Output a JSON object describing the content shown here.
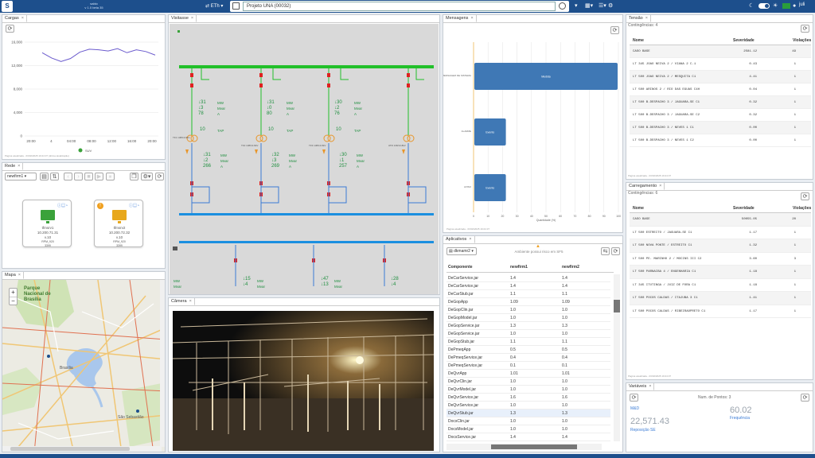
{
  "topbar": {
    "brand_line1": "sabio",
    "brand_line2": "v 1.0 beta 35",
    "eth_label": "ETh",
    "project": "Projeto UNA (00032)",
    "user": "juli"
  },
  "tabs": {
    "cargas": "Cargas",
    "visitasse": "Visitasse",
    "mensagens": "Mensagens",
    "tensao": "Tensão",
    "rede": "Rede",
    "mapa": "Mapa",
    "camera": "Câmera",
    "aplicativos": "Aplicativos",
    "carregamento": "Carregamento",
    "variaveis": "Variáveis"
  },
  "cargas": {
    "yticks": [
      "16,000",
      "12,000",
      "8,000",
      "4,000",
      "0"
    ],
    "xticks": [
      "20:00",
      "4",
      "04:00",
      "08:00",
      "12:00",
      "16:00",
      "20:00"
    ],
    "legend": "SUV",
    "footer": "Página atualizada - 03/02/2025 19:24:37 (última atualização)"
  },
  "rede": {
    "select": "newfirm1",
    "nodes": [
      {
        "name": "tfmsrv1",
        "ip": "10.200.71.31",
        "ver": "v.10",
        "os": "RPM_920",
        "code": "3399"
      },
      {
        "name": "tfmsrv2",
        "ip": "10.200.72.32",
        "ver": "v.10",
        "os": "RPM_920",
        "code": "3399"
      }
    ]
  },
  "mapa": {
    "park": "Parque Nacional de Brasília",
    "city": "Brasília",
    "place1": "São Sebastião",
    "zoom_in": "+",
    "zoom_out": "−"
  },
  "sld": {
    "feeders": [
      {
        "a": "31",
        "b": "3",
        "c": "78",
        "d": "10",
        "e": "31",
        "f": "2",
        "g": "266",
        "h": "15",
        "i": "4"
      },
      {
        "a": "31",
        "b": "0",
        "c": "80",
        "d": "10",
        "e": "32",
        "f": "3",
        "g": "269",
        "h": "",
        "i": ""
      },
      {
        "a": "30",
        "b": "2",
        "c": "76",
        "d": "10",
        "e": "30",
        "f": "1",
        "g": "257",
        "h": "47",
        "i": "13"
      }
    ],
    "last": {
      "h": "28",
      "i": "4"
    },
    "units": {
      "mw": "MW",
      "mvar": "Mvar",
      "a": "A",
      "tap": "TAP"
    },
    "trafos": [
      "TF1 138/13.8kV",
      "TF2 138/13.8kV",
      "TF3 138/13.8kV",
      "ATR 138/13.8kV"
    ]
  },
  "mensagens": {
    "bars": [
      {
        "label": "Medida",
        "value": 100,
        "cat": "MENSAGEM DE SISTEMA"
      },
      {
        "label": "Evento",
        "value": 22,
        "cat": "ALARME"
      },
      {
        "label": "Evento",
        "value": 22,
        "cat": "AVISO"
      }
    ],
    "xticks": [
      "0",
      "10",
      "20",
      "30",
      "40",
      "50",
      "60",
      "70",
      "80",
      "90",
      "100"
    ],
    "xlabel": "Quantidade (%)",
    "footer": "Página atualizada - 03/02/2025 19:24:37"
  },
  "aplicativos": {
    "select": "dkmamr2",
    "warning": "Ambiente possui risco em SF5",
    "columns": [
      "Componente",
      "newfirm1",
      "newfirm2"
    ],
    "rows": [
      [
        "DeCarService.jar",
        "1.4",
        "1.4"
      ],
      [
        "DeCarService.jar",
        "1.4",
        "1.4"
      ],
      [
        "DeCarStub.jar",
        "1.1",
        "1.1"
      ],
      [
        "DeGopApp",
        "1.09",
        "1.09"
      ],
      [
        "DeGopClin.jar",
        "1.0",
        "1.0"
      ],
      [
        "DeGopModel.jar",
        "1.0",
        "1.0"
      ],
      [
        "DeGopService.jar",
        "1.3",
        "1.3"
      ],
      [
        "DeGopService.jar",
        "1.0",
        "1.0"
      ],
      [
        "DeGopStub.jar",
        "1.1",
        "1.1"
      ],
      [
        "DePmeqApp",
        "0.5",
        "0.5"
      ],
      [
        "DePmeqService.jar",
        "0.4",
        "0.4"
      ],
      [
        "DePmeqService.jar",
        "0.1",
        "0.1"
      ],
      [
        "DeQvrApp",
        "1.01",
        "1.01"
      ],
      [
        "DeQvrClin.jar",
        "1.0",
        "1.0"
      ],
      [
        "DeQvrModel.jar",
        "1.0",
        "1.0"
      ],
      [
        "DeQvrService.jar",
        "1.6",
        "1.6"
      ],
      [
        "DeQvrService.jar",
        "1.0",
        "1.0"
      ],
      [
        "DeQvrStub.jar",
        "1.3",
        "1.3"
      ],
      [
        "DocsClin.jar",
        "1.0",
        "1.0"
      ],
      [
        "DocsModel.jar",
        "1.0",
        "1.0"
      ],
      [
        "DocsService.jar",
        "1.4",
        "1.4"
      ]
    ]
  },
  "tensao": {
    "subtitle": "Contingências: 4",
    "columns": [
      "Nome",
      "Severidade",
      "Violações"
    ],
    "rows": [
      [
        "CASO BASE",
        "2581.12",
        "49"
      ],
      [
        "LT 345 JOAO NEIVA 2 / VIANA 2 C.1",
        "0.43",
        "1"
      ],
      [
        "LT 500 JOAO NEIVA 2 / MESQUITA C1",
        "4.41",
        "1"
      ],
      [
        "LT 500 ARINOS 2 / RIO DAS EGUAS C4H",
        "0.04",
        "1"
      ],
      [
        "LT 500 B.DESPACHO 3 / JAGUARA-SE C1",
        "0.32",
        "1"
      ],
      [
        "LT 500 B.DESPACHO 3 / JAGUARA-SE C2",
        "0.32",
        "1"
      ],
      [
        "LT 500 B.DESPACHO 3 / NEVES 1 C1",
        "0.00",
        "1"
      ],
      [
        "LT 500 B.DESPACHO 3 / NEVES 1 C2",
        "0.00",
        "1"
      ]
    ],
    "footer": "Página atualizada - 03/02/2025 19:24:37"
  },
  "carregamento": {
    "subtitle": "Contingências: 6",
    "columns": [
      "Nome",
      "Severidade",
      "Violações"
    ],
    "rows": [
      [
        "CASO BASE",
        "50055.05",
        "20"
      ],
      [
        "LT 500 ESTREITO / JAGUARA-SE C1",
        "1.17",
        "1"
      ],
      [
        "LT 500 NOVA PONTE / ESTREITO C1",
        "1.32",
        "1"
      ],
      [
        "LT 500 PE. MARINHO 2 / MOCINS III C2",
        "3.60",
        "3"
      ],
      [
        "LT 500 PARNAIBA 4 / ENGENHARIA C1",
        "1.18",
        "1"
      ],
      [
        "LT 345 ITUTINGA / JUIZ DE FORA C1",
        "1.18",
        "1"
      ],
      [
        "LT 500 POCOS CALDAS / ITAJUBA 3 C1",
        "1.41",
        "1"
      ],
      [
        "LT 500 POCOS CALDAS / RIBEIRAOPRETO C1",
        "1.17",
        "1"
      ]
    ],
    "footer": "Página atualizada - 03/02/2025 19:24:37"
  },
  "variaveis": {
    "header": "Num. de Pontos: 3",
    "left_top": "M&D",
    "big_left": "22,571.43",
    "big_left_label": "Reposição SE",
    "big_right": "60.02",
    "big_right_label": "Frequência"
  },
  "chart_data": {
    "type": "line",
    "x": [
      "20:00",
      "22:00",
      "00:00",
      "02:00",
      "04:00",
      "06:00",
      "08:00",
      "10:00",
      "12:00",
      "14:00",
      "16:00",
      "18:00",
      "20:00"
    ],
    "series": [
      {
        "name": "SUV",
        "values": [
          14200,
          13300,
          12700,
          13200,
          14300,
          14800,
          14700,
          14500,
          14900,
          14200,
          14700,
          14400,
          13800
        ]
      }
    ],
    "ylim": [
      0,
      16000
    ]
  }
}
